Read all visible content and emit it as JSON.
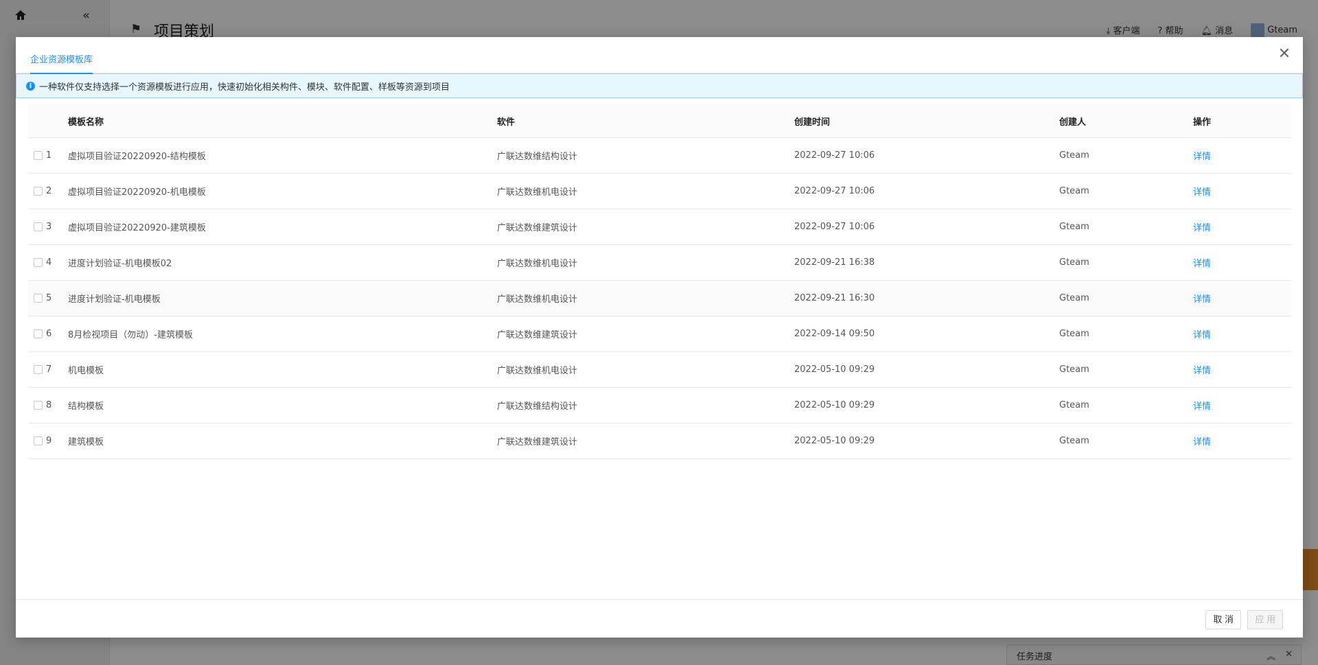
{
  "app": {
    "page_title": "项目策划",
    "top_actions": [
      "客户端",
      "帮助",
      "消息"
    ],
    "user_name": "Gteam",
    "task_panel_title": "任务进度"
  },
  "modal": {
    "tab_label": "企业资源模板库",
    "notice": "一种软件仅支持选择一个资源模板进行应用，快速初始化相关构件、模块、软件配置、样板等资源到项目",
    "columns": {
      "name": "模板名称",
      "software": "软件",
      "created_time": "创建时间",
      "creator": "创建人",
      "action": "操作"
    },
    "rows": [
      {
        "index": "1",
        "name": "虚拟项目验证20220920-结构模板",
        "software": "广联达数维结构设计",
        "time": "2022-09-27 10:06",
        "creator": "Gteam",
        "action": "详情"
      },
      {
        "index": "2",
        "name": "虚拟项目验证20220920-机电模板",
        "software": "广联达数维机电设计",
        "time": "2022-09-27 10:06",
        "creator": "Gteam",
        "action": "详情"
      },
      {
        "index": "3",
        "name": "虚拟项目验证20220920-建筑模板",
        "software": "广联达数维建筑设计",
        "time": "2022-09-27 10:06",
        "creator": "Gteam",
        "action": "详情"
      },
      {
        "index": "4",
        "name": "进度计划验证-机电模板02",
        "software": "广联达数维机电设计",
        "time": "2022-09-21 16:38",
        "creator": "Gteam",
        "action": "详情"
      },
      {
        "index": "5",
        "name": "进度计划验证-机电模板",
        "software": "广联达数维机电设计",
        "time": "2022-09-21 16:30",
        "creator": "Gteam",
        "action": "详情"
      },
      {
        "index": "6",
        "name": "8月检视项目（勿动）-建筑模板",
        "software": "广联达数维建筑设计",
        "time": "2022-09-14 09:50",
        "creator": "Gteam",
        "action": "详情"
      },
      {
        "index": "7",
        "name": "机电模板",
        "software": "广联达数维机电设计",
        "time": "2022-05-10 09:29",
        "creator": "Gteam",
        "action": "详情"
      },
      {
        "index": "8",
        "name": "结构模板",
        "software": "广联达数维结构设计",
        "time": "2022-05-10 09:29",
        "creator": "Gteam",
        "action": "详情"
      },
      {
        "index": "9",
        "name": "建筑模板",
        "software": "广联达数维建筑设计",
        "time": "2022-05-10 09:29",
        "creator": "Gteam",
        "action": "详情"
      }
    ],
    "cancel_label": "取 消",
    "apply_label": "应 用",
    "hover_row_index": "5"
  },
  "colors": {
    "accent": "#1890ff",
    "alert_bg": "#e6f7ff"
  }
}
